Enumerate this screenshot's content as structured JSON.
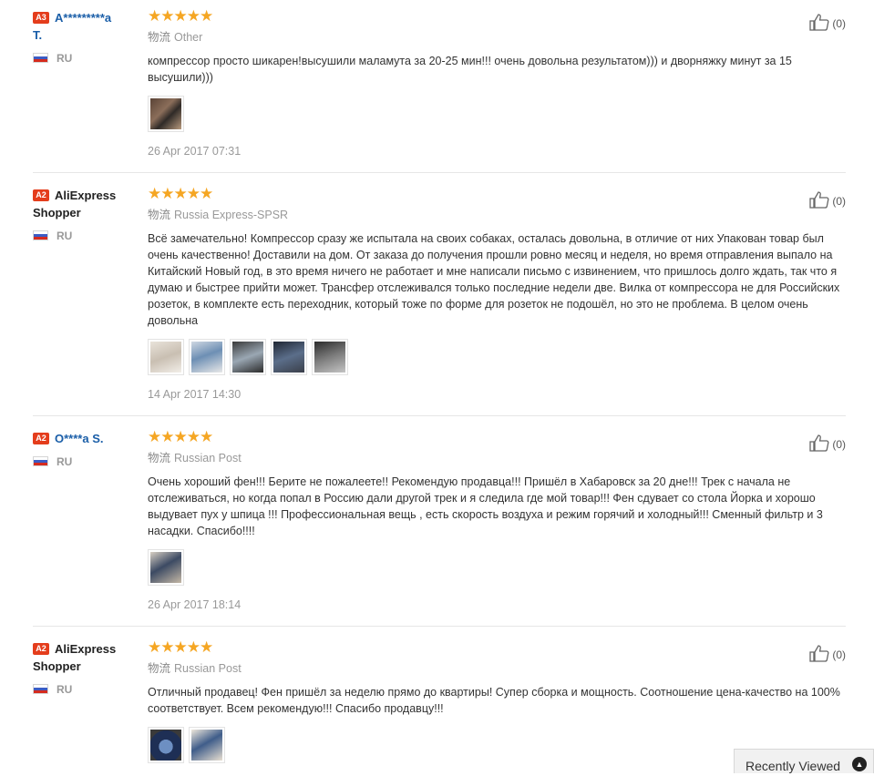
{
  "reviews": [
    {
      "level": "A3",
      "name_line1": "A*********a",
      "name_line2": "T.",
      "country": "RU",
      "logistics_label": "物流",
      "logistics": "Other",
      "text": "компрессор просто шикарен!высушили маламута за 20-25 мин!!! очень довольна результатом))) и дворняжку минут за 15 высушили)))",
      "date": "26 Apr 2017 07:31",
      "likes": "(0)",
      "images": [
        "photo"
      ]
    },
    {
      "level": "A2",
      "name_line1": "AliExpress",
      "name_line2": "Shopper",
      "country": "RU",
      "logistics_label": "物流",
      "logistics": "Russia Express-SPSR",
      "text": "Всё замечательно! Компрессор сразу же испытала на своих собаках, осталась довольна, в отличие от них Упакован товар был очень качественно! Доставили на дом. От заказа до получения прошли ровно месяц и неделя, но время отправления выпало на Китайский Новый год, в это время ничего не работает и мне написали письмо с извинением, что пришлось долго ждать, так что я думаю и быстрее прийти может. Трансфер отслеживался только последние недели две. Вилка от компрессора не для Российских розеток, в комплекте есть переходник, который тоже по форме для розеток не подошёл, но это не проблема. В целом очень довольна",
      "date": "14 Apr 2017 14:30",
      "likes": "(0)",
      "images": [
        "photo",
        "photo",
        "photo",
        "photo",
        "photo"
      ]
    },
    {
      "level": "A2",
      "name_line1": "O****a S.",
      "name_line2": "",
      "country": "RU",
      "logistics_label": "物流",
      "logistics": "Russian Post",
      "text": "Очень хороший фен!!! Берите не пожалеете!! Рекомендую продавца!!! Пришёл в Хабаровск за 20 дне!!! Трек с начала не отслеживаться, но когда попал в Россию дали другой трек и я следила где мой товар!!! Фен сдувает со стола Йорка и хорошо выдувает пух у шпица !!! Профессиональная вещь , есть скорость воздуха и режим горячий и холодный!!! Сменный фильтр и 3 насадки. Спасибо!!!!",
      "date": "26 Apr 2017 18:14",
      "likes": "(0)",
      "images": [
        "photo"
      ]
    },
    {
      "level": "A2",
      "name_line1": "AliExpress",
      "name_line2": "Shopper",
      "country": "RU",
      "logistics_label": "物流",
      "logistics": "Russian Post",
      "text": "Отличный продавец! Фен пришёл за неделю прямо до квартиры! Супер сборка и мощность. Соотношение цена-качество на 100% соответствует. Всем рекомендую!!! Спасибо продавцу!!!",
      "date": "",
      "likes": "(0)",
      "images": [
        "photo",
        "photo"
      ]
    }
  ],
  "recently_viewed": {
    "label": "Recently Viewed",
    "icon": "chevron-up-icon"
  },
  "colors": {
    "star": "#f5a623",
    "level_badge": "#e43d1c",
    "link": "#1a5ea8"
  }
}
